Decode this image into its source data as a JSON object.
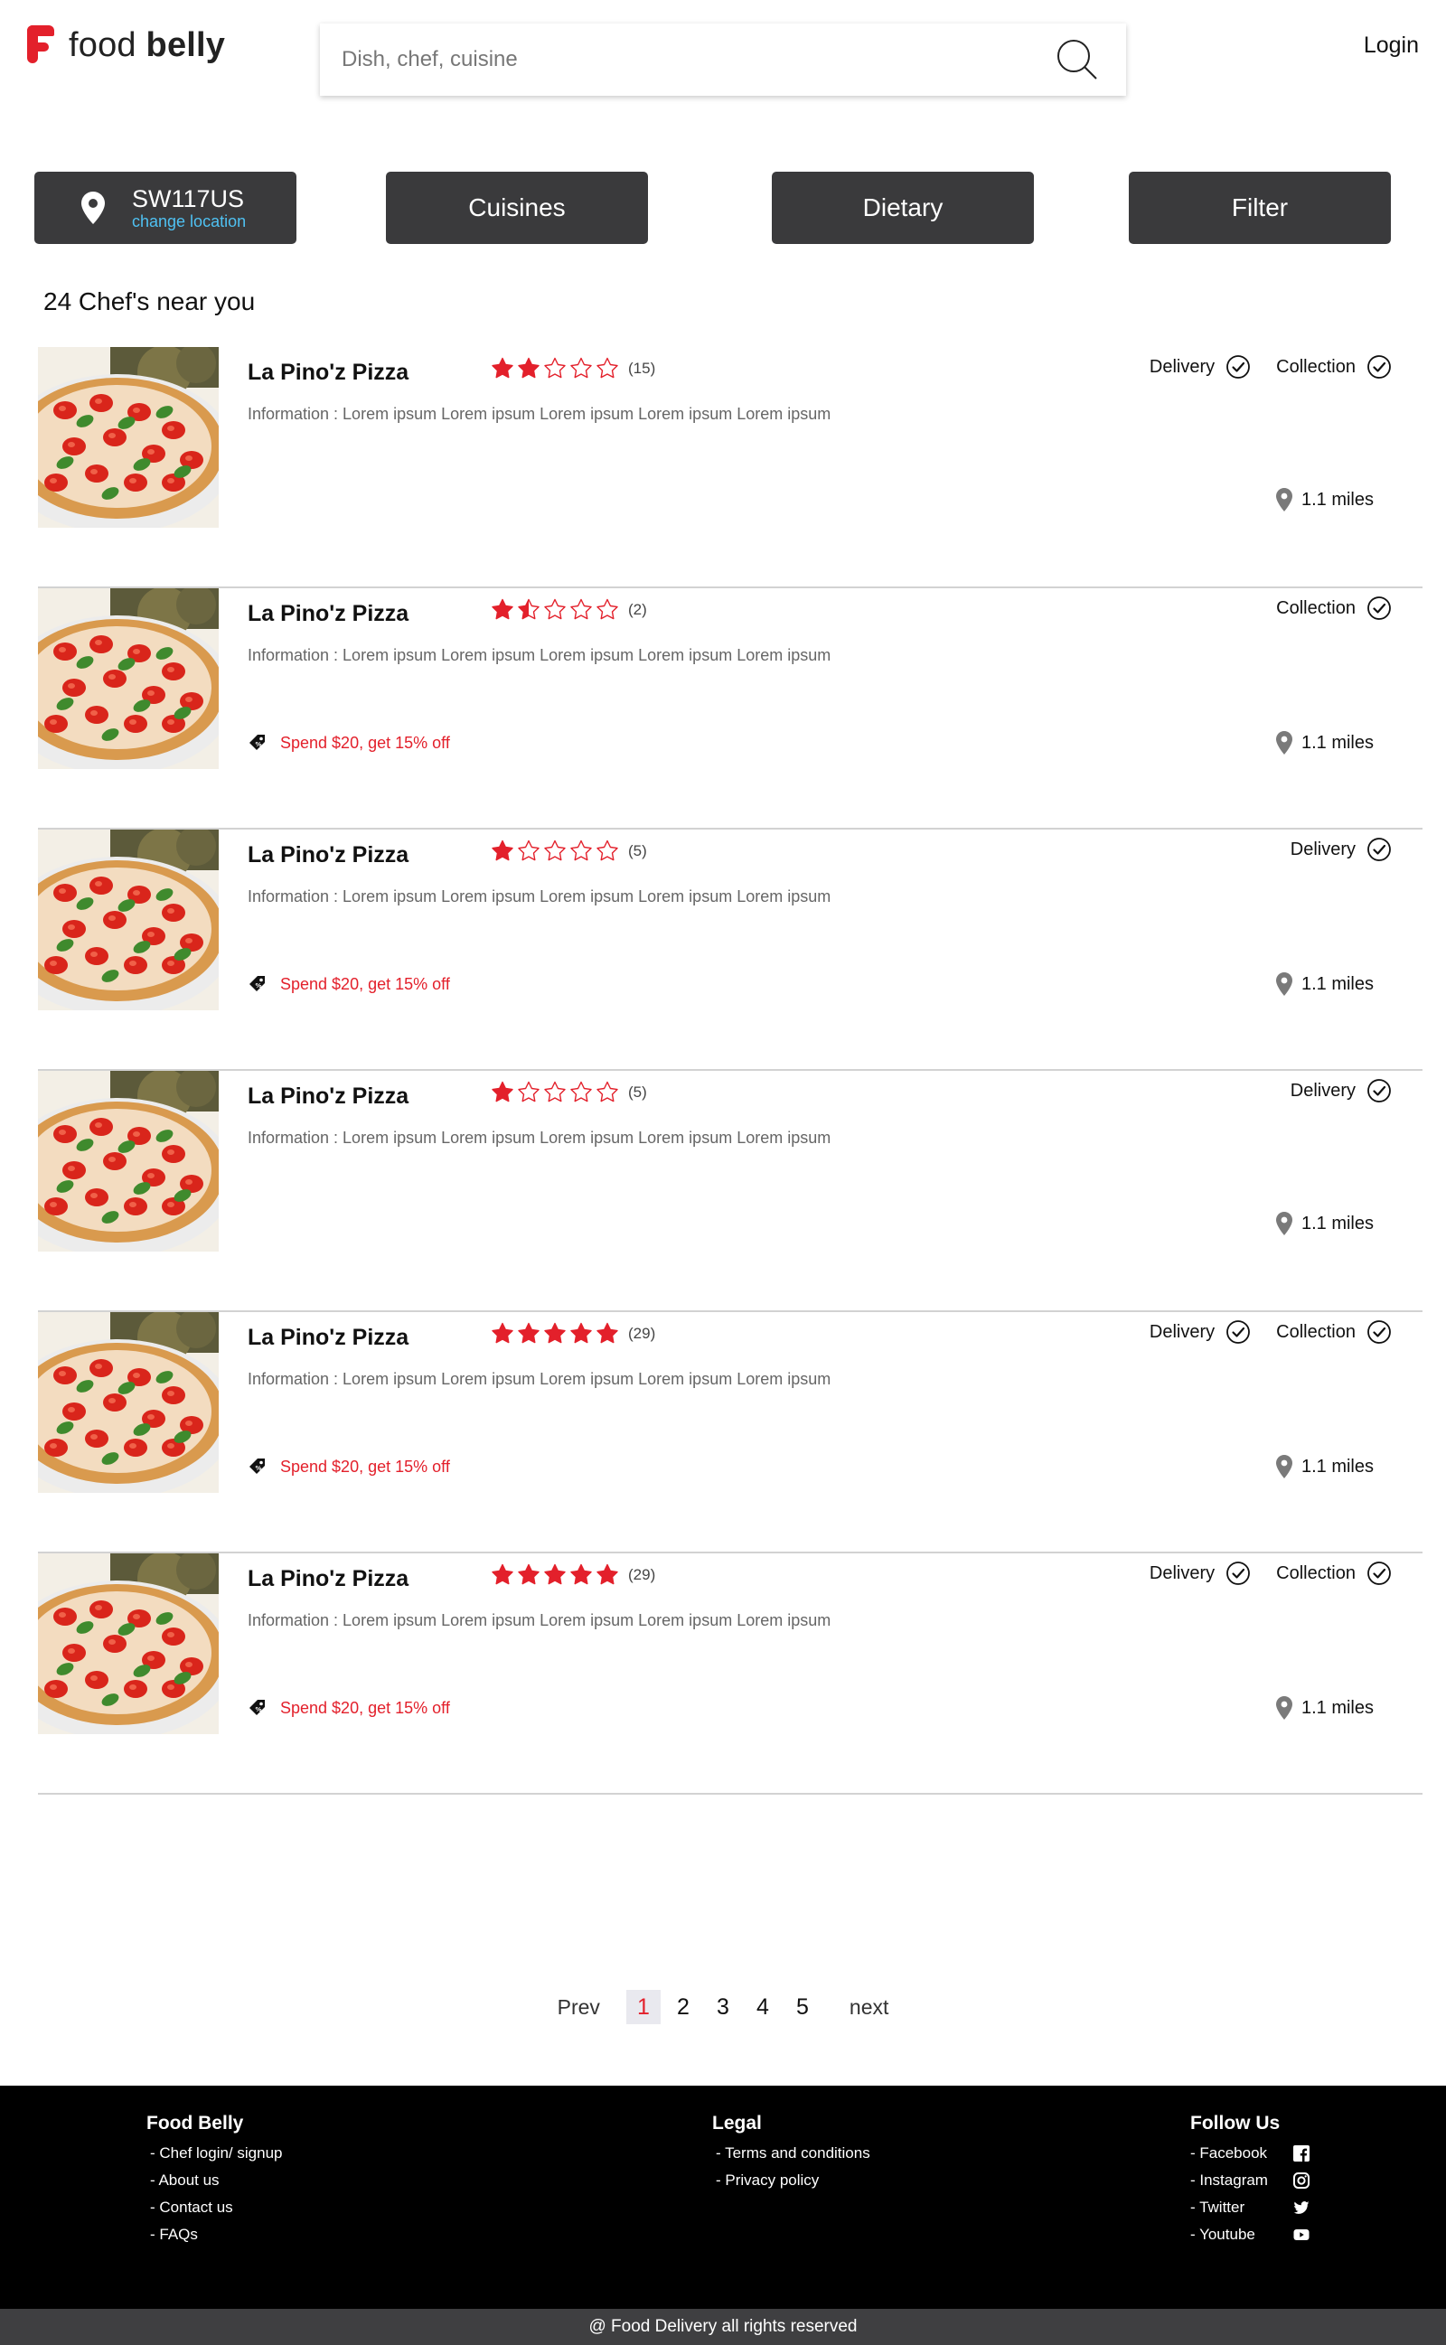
{
  "header": {
    "logo_light": "food",
    "logo_bold": "belly",
    "search_placeholder": "Dish, chef, cuisine",
    "login_label": "Login"
  },
  "actions": {
    "location_code": "SW117US",
    "change_location": "change location",
    "cuisines": "Cuisines",
    "dietary": "Dietary",
    "filter": "Filter"
  },
  "results_title": "24 Chef's near you",
  "colors": {
    "accent": "#e3202b",
    "button_bg": "#3a3a3c",
    "link_blue": "#4fc1f2"
  },
  "listings": [
    {
      "name": "La Pino'z Pizza",
      "rating": 2,
      "reviews": "(15)",
      "info": "Information : Lorem ipsum  Lorem ipsum Lorem ipsum Lorem ipsum Lorem ipsum",
      "offer": "",
      "delivery": "Delivery",
      "collection": "Collection",
      "distance": "1.1 miles"
    },
    {
      "name": "La Pino'z Pizza",
      "rating": 1.5,
      "reviews": "(2)",
      "info": "Information : Lorem ipsum  Lorem ipsum Lorem ipsum Lorem ipsum Lorem ipsum",
      "offer": "Spend $20, get 15% off",
      "delivery": "",
      "collection": "Collection",
      "distance": "1.1 miles"
    },
    {
      "name": "La Pino'z Pizza",
      "rating": 1,
      "reviews": "(5)",
      "info": "Information : Lorem ipsum  Lorem ipsum Lorem ipsum Lorem ipsum Lorem ipsum",
      "offer": "Spend $20, get 15% off",
      "delivery": "Delivery",
      "collection": "",
      "distance": "1.1 miles"
    },
    {
      "name": "La Pino'z Pizza",
      "rating": 1,
      "reviews": "(5)",
      "info": "Information : Lorem ipsum  Lorem ipsum Lorem ipsum Lorem ipsum Lorem ipsum",
      "offer": "",
      "delivery": "Delivery",
      "collection": "",
      "distance": "1.1 miles"
    },
    {
      "name": "La Pino'z Pizza",
      "rating": 5,
      "reviews": "(29)",
      "info": "Information : Lorem ipsum  Lorem ipsum Lorem ipsum Lorem ipsum Lorem ipsum",
      "offer": "Spend $20, get 15% off",
      "delivery": "Delivery",
      "collection": "Collection",
      "distance": "1.1 miles"
    },
    {
      "name": "La Pino'z Pizza",
      "rating": 5,
      "reviews": "(29)",
      "info": "Information : Lorem ipsum  Lorem ipsum Lorem ipsum Lorem ipsum Lorem ipsum",
      "offer": "Spend $20, get 15% off",
      "delivery": "Delivery",
      "collection": "Collection",
      "distance": "1.1 miles"
    }
  ],
  "pagination": {
    "prev": "Prev",
    "pages": [
      "1",
      "2",
      "3",
      "4",
      "5"
    ],
    "current": "1",
    "next": "next"
  },
  "footer": {
    "col1": {
      "title": "Food Belly",
      "links": [
        "- Chef login/ signup",
        "- About us",
        "- Contact us",
        "- FAQs"
      ]
    },
    "col2": {
      "title": "Legal",
      "links": [
        "- Terms and conditions",
        "- Privacy policy"
      ]
    },
    "col3": {
      "title": "Follow Us",
      "links": [
        {
          "label": "- Facebook",
          "icon": "facebook-icon"
        },
        {
          "label": "- Instagram",
          "icon": "instagram-icon"
        },
        {
          "label": "- Twitter",
          "icon": "twitter-icon"
        },
        {
          "label": "- Youtube",
          "icon": "youtube-icon"
        }
      ]
    },
    "copyright": "@ Food Delivery all rights reserved"
  }
}
